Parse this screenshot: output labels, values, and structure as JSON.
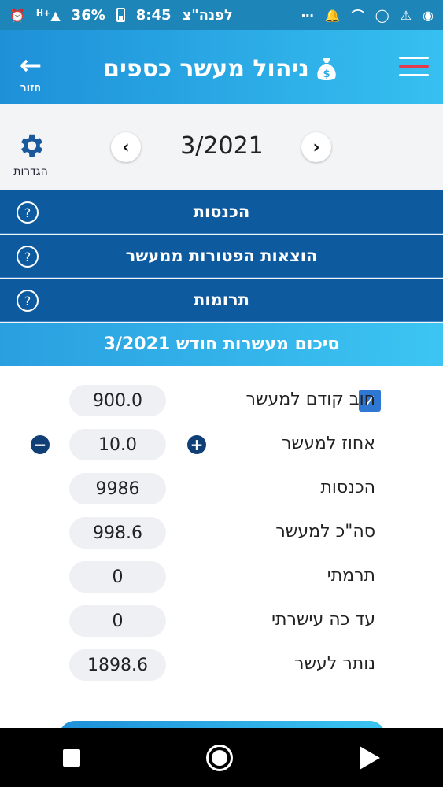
{
  "status_bar": {
    "carrier": "לפנה\"צ",
    "time": "8:45",
    "battery": "36%",
    "network": "H+",
    "icons": [
      "battery-icon",
      "network-icon",
      "alarm-icon",
      "more-icon",
      "bell-icon",
      "voicemail-icon",
      "whatsapp-icon",
      "warning-icon",
      "hotspot-icon"
    ]
  },
  "app_bar": {
    "title": "ניהול מעשר כספים",
    "back_label": "חזור",
    "colors": {
      "gradient_start": "#1e90d8",
      "gradient_end": "#36c0f0",
      "menu_accent": "#e53950"
    }
  },
  "nav": {
    "month": "3/2021",
    "settings_label": "הגדרות"
  },
  "sections": [
    {
      "label": "הכנסות",
      "help": "?"
    },
    {
      "label": "הוצאות הפטורות ממעשר",
      "help": "?"
    },
    {
      "label": "תרומות",
      "help": "?"
    }
  ],
  "summary": {
    "title": "סיכום מעשרות חודש 3/2021",
    "rows": [
      {
        "label": "חוב קודם למעשר",
        "value": "900.0",
        "checked": true
      },
      {
        "label": "אחוז למעשר",
        "value": "10.0"
      },
      {
        "label": "הכנסות",
        "value": "9986"
      },
      {
        "label": "סה\"כ למעשר",
        "value": "998.6"
      },
      {
        "label": "תרמתי",
        "value": "0"
      },
      {
        "label": "עד כה עישרתי",
        "value": "0"
      },
      {
        "label": "נותר לעשר",
        "value": "1898.6"
      }
    ],
    "plus": "+",
    "minus": "−",
    "check": "✓"
  }
}
